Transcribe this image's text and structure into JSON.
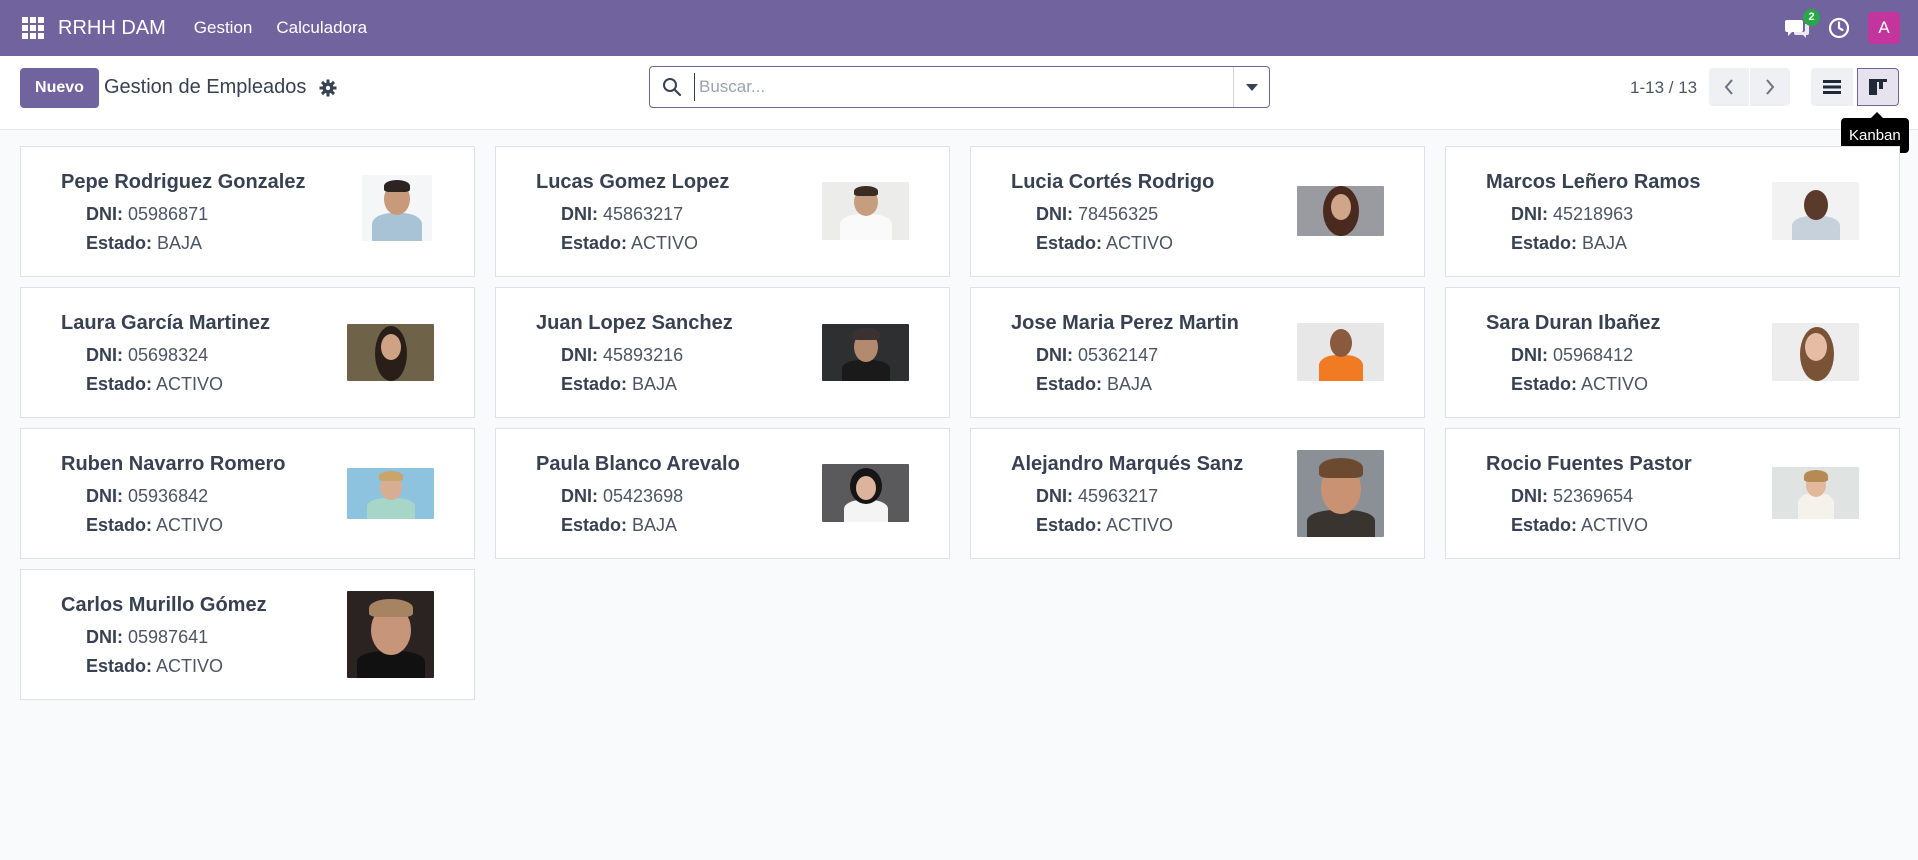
{
  "navbar": {
    "brand": "RRHH DAM",
    "menu": [
      "Gestion",
      "Calculadora"
    ],
    "chat_badge": "2",
    "user_initial": "A"
  },
  "control": {
    "new_button": "Nuevo",
    "title": "Gestion de Empleados",
    "search_placeholder": "Buscar...",
    "pager": "1-13 / 13",
    "tooltip": "Kanban"
  },
  "labels": {
    "dni": "DNI:",
    "estado": "Estado:"
  },
  "employees": [
    {
      "name": "Pepe Rodriguez Gonzalez",
      "dni": "05986871",
      "estado": "BAJA"
    },
    {
      "name": "Lucas Gomez Lopez",
      "dni": "45863217",
      "estado": "ACTIVO"
    },
    {
      "name": "Lucia Cortés Rodrigo",
      "dni": "78456325",
      "estado": "ACTIVO"
    },
    {
      "name": "Marcos Leñero Ramos",
      "dni": "45218963",
      "estado": "BAJA"
    },
    {
      "name": "Laura García Martinez",
      "dni": "05698324",
      "estado": "ACTIVO"
    },
    {
      "name": "Juan Lopez Sanchez",
      "dni": "45893216",
      "estado": "BAJA"
    },
    {
      "name": "Jose Maria Perez Martin",
      "dni": "05362147",
      "estado": "BAJA"
    },
    {
      "name": "Sara Duran Ibañez",
      "dni": "05968412",
      "estado": "ACTIVO"
    },
    {
      "name": "Ruben Navarro Romero",
      "dni": "05936842",
      "estado": "ACTIVO"
    },
    {
      "name": "Paula Blanco Arevalo",
      "dni": "05423698",
      "estado": "BAJA"
    },
    {
      "name": "Alejandro Marqués Sanz",
      "dni": "45963217",
      "estado": "ACTIVO"
    },
    {
      "name": "Rocio Fuentes Pastor",
      "dni": "52369654",
      "estado": "ACTIVO"
    },
    {
      "name": "Carlos Murillo Gómez",
      "dni": "05987641",
      "estado": "ACTIVO"
    }
  ],
  "colors": {
    "brand": "#71639e",
    "avatar": "#c1359d",
    "badge": "#28a745"
  }
}
